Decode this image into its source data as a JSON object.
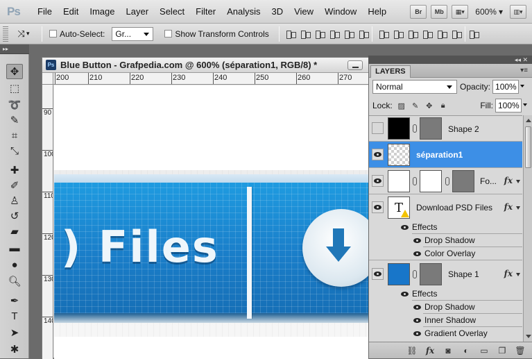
{
  "app": {
    "logo": "Ps"
  },
  "menu": [
    "File",
    "Edit",
    "Image",
    "Layer",
    "Select",
    "Filter",
    "Analysis",
    "3D",
    "View",
    "Window",
    "Help"
  ],
  "menu_right": {
    "bridge": "Br",
    "minibridge": "Mb",
    "zoom": "600%"
  },
  "options": {
    "auto_select_label": "Auto-Select:",
    "auto_select_value": "Gr...",
    "transform_label": "Show Transform Controls"
  },
  "document": {
    "title": "Blue Button - Grafpedia.com @ 600% (séparation1, RGB/8) *",
    "ruler_h": [
      "200",
      "210",
      "220",
      "230",
      "240",
      "250",
      "260",
      "270"
    ],
    "ruler_v": [
      "90",
      "100",
      "110",
      "120",
      "130",
      "140"
    ],
    "button_text": ") Files"
  },
  "layers_panel": {
    "tab": "LAYERS",
    "blend_mode": "Normal",
    "opacity_label": "Opacity:",
    "opacity": "100%",
    "lock_label": "Lock:",
    "fill_label": "Fill:",
    "fill": "100%",
    "layers": [
      {
        "name": "Shape 2",
        "visible": false,
        "fx": false
      },
      {
        "name": "séparation1",
        "visible": true,
        "selected": true
      },
      {
        "name": "Fo...",
        "visible": true,
        "fx": true
      },
      {
        "name": "Download PSD Files",
        "visible": true,
        "fx": true
      },
      {
        "name": "Shape 1",
        "visible": true,
        "fx": true
      }
    ],
    "effects_label": "Effects",
    "text_layer_effects": [
      "Drop Shadow",
      "Color Overlay"
    ],
    "shape1_effects": [
      "Drop Shadow",
      "Inner Shadow",
      "Gradient Overlay"
    ],
    "fx_symbol": "fx"
  }
}
